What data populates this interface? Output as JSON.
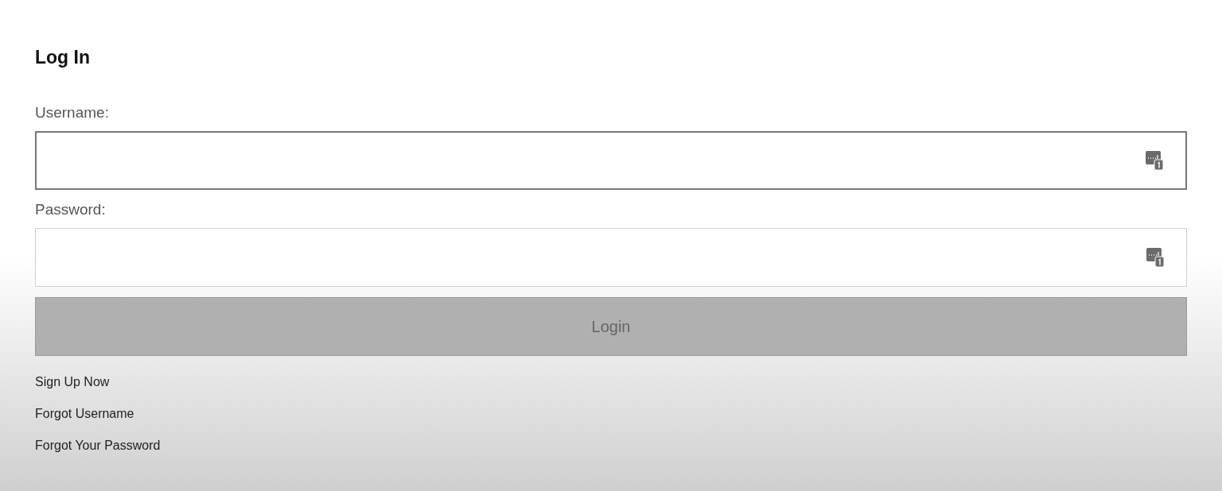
{
  "title": "Log In",
  "fields": [
    {
      "label": "Username:",
      "focused": true
    },
    {
      "label": "Password:",
      "focused": false
    }
  ],
  "login_button": {
    "label": "Login",
    "disabled": true
  },
  "links": [
    "Sign Up Now",
    "Forgot Username",
    "Forgot Your Password"
  ]
}
